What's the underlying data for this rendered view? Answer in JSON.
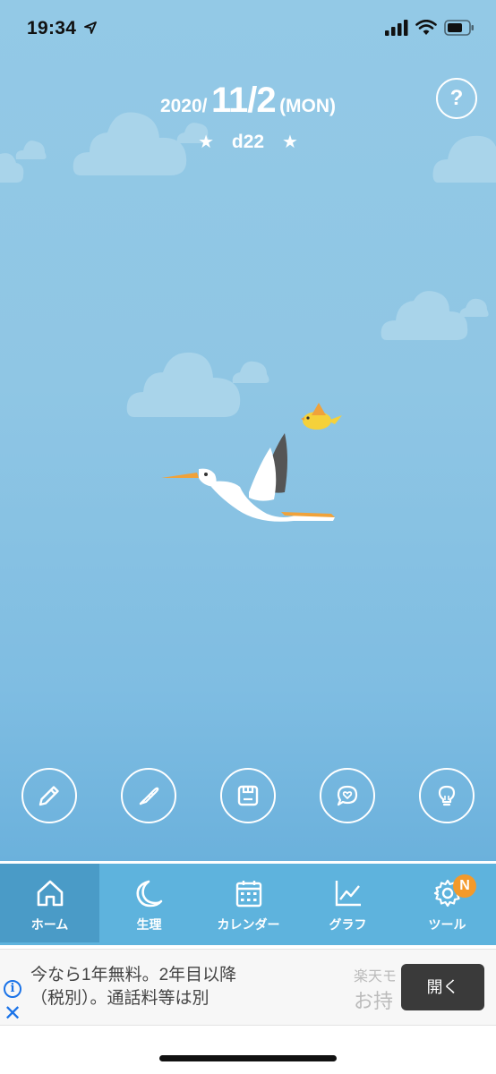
{
  "status_bar": {
    "time": "19:34",
    "icons": [
      "location-arrow-icon",
      "cellular-signal-icon",
      "wifi-icon",
      "battery-icon"
    ]
  },
  "header": {
    "year": "2020/",
    "month_day": "11/2",
    "weekday": "(MON)",
    "star_left": "★",
    "day_label": "d22",
    "star_right": "★",
    "help_label": "?"
  },
  "actions": [
    {
      "name": "pencil-icon"
    },
    {
      "name": "thermometer-icon"
    },
    {
      "name": "weight-scale-icon"
    },
    {
      "name": "heart-chat-icon"
    },
    {
      "name": "lightbulb-icon"
    }
  ],
  "tabbar": {
    "tabs": [
      {
        "label": "ホーム",
        "icon": "home-icon",
        "active": true
      },
      {
        "label": "生理",
        "icon": "moon-icon",
        "active": false
      },
      {
        "label": "カレンダー",
        "icon": "calendar-icon",
        "active": false
      },
      {
        "label": "グラフ",
        "icon": "chart-icon",
        "active": false
      },
      {
        "label": "ツール",
        "icon": "gear-icon",
        "active": false,
        "badge": "N"
      }
    ]
  },
  "ad": {
    "info_label": "i",
    "close_label": "✕",
    "text_line1": "今なら1年無料。2年目以降",
    "text_line2": "（税別）。通話料等は別",
    "brand_line1": "楽天モ",
    "brand_line2": "お持",
    "open_label": "開く"
  },
  "colors": {
    "sky_top": "#93c9e6",
    "sky_bottom": "#6bb1dc",
    "tabbar": "#5eb3dd",
    "tab_active": "#4a9bc7",
    "badge": "#f39a2b"
  }
}
